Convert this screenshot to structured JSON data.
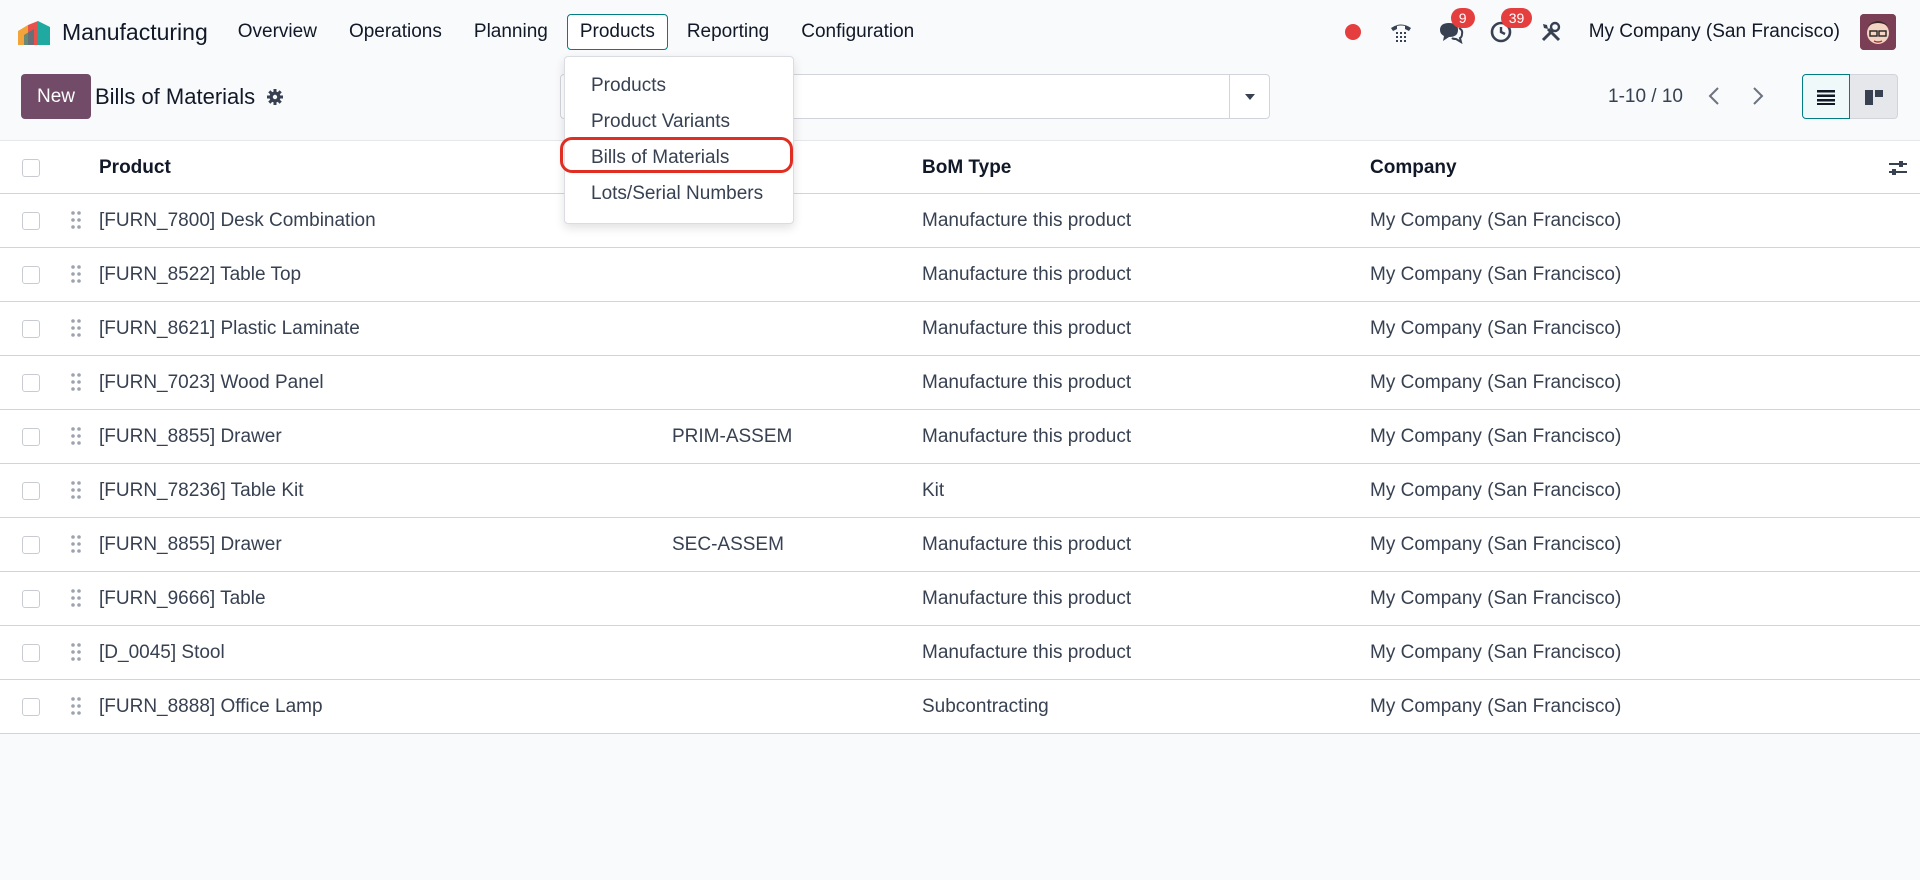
{
  "app": {
    "name": "Manufacturing"
  },
  "menu": [
    "Overview",
    "Operations",
    "Planning",
    "Products",
    "Reporting",
    "Configuration"
  ],
  "active_menu": "Products",
  "notifications": {
    "messages_count": "9",
    "activities_count": "39"
  },
  "company": "My Company (San Francisco)",
  "control": {
    "new_label": "New",
    "title": "Bills of Materials",
    "pager": "1-10 / 10"
  },
  "dropdown": {
    "items": [
      "Products",
      "Product Variants",
      "Bills of Materials",
      "Lots/Serial Numbers"
    ],
    "highlighted": "Bills of Materials"
  },
  "table": {
    "headers": {
      "product": "Product",
      "bom_type": "BoM Type",
      "company": "Company"
    },
    "rows": [
      {
        "product": "[FURN_7800] Desk Combination",
        "reference": "",
        "bom_type": "Manufacture this product",
        "company": "My Company (San Francisco)"
      },
      {
        "product": "[FURN_8522] Table Top",
        "reference": "",
        "bom_type": "Manufacture this product",
        "company": "My Company (San Francisco)"
      },
      {
        "product": "[FURN_8621] Plastic Laminate",
        "reference": "",
        "bom_type": "Manufacture this product",
        "company": "My Company (San Francisco)"
      },
      {
        "product": "[FURN_7023] Wood Panel",
        "reference": "",
        "bom_type": "Manufacture this product",
        "company": "My Company (San Francisco)"
      },
      {
        "product": "[FURN_8855] Drawer",
        "reference": "PRIM-ASSEM",
        "bom_type": "Manufacture this product",
        "company": "My Company (San Francisco)"
      },
      {
        "product": "[FURN_78236] Table Kit",
        "reference": "",
        "bom_type": "Kit",
        "company": "My Company (San Francisco)"
      },
      {
        "product": "[FURN_8855] Drawer",
        "reference": "SEC-ASSEM",
        "bom_type": "Manufacture this product",
        "company": "My Company (San Francisco)"
      },
      {
        "product": "[FURN_9666] Table",
        "reference": "",
        "bom_type": "Manufacture this product",
        "company": "My Company (San Francisco)"
      },
      {
        "product": "[D_0045] Stool",
        "reference": "",
        "bom_type": "Manufacture this product",
        "company": "My Company (San Francisco)"
      },
      {
        "product": "[FURN_8888] Office Lamp",
        "reference": "",
        "bom_type": "Subcontracting",
        "company": "My Company (San Francisco)"
      }
    ]
  },
  "colors": {
    "primary": "#714b67",
    "accent": "#017e84",
    "badge": "#e53e3e",
    "highlight": "#e02f22"
  },
  "icons": [
    "manufacturing-logo-icon",
    "record-dot-icon",
    "phone-icon",
    "chat-icon",
    "clock-icon",
    "tools-icon",
    "gear-icon",
    "caret-down-icon",
    "chevron-left-icon",
    "chevron-right-icon",
    "list-view-icon",
    "kanban-view-icon",
    "drag-handle-icon",
    "column-settings-icon"
  ]
}
